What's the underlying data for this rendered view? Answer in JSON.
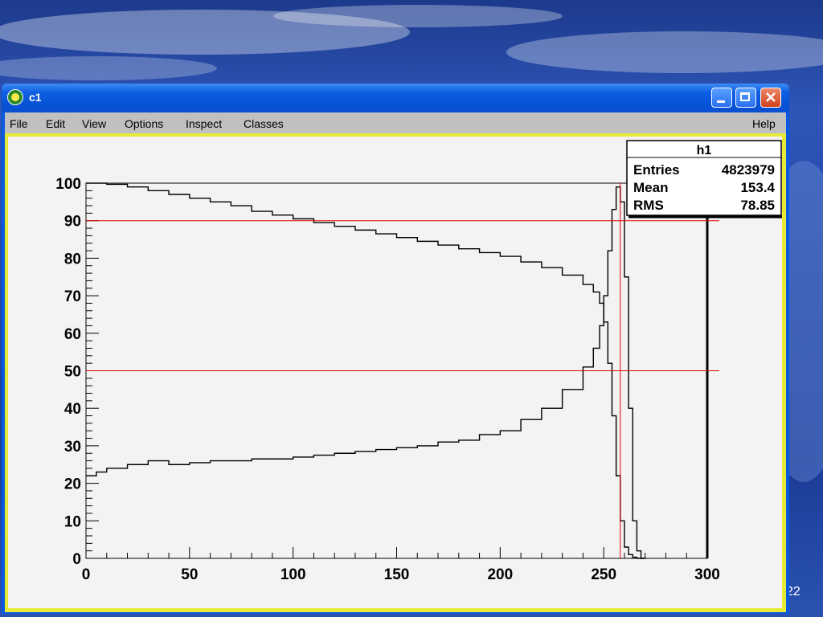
{
  "window": {
    "title": "c1",
    "menu": [
      "File",
      "Edit",
      "View",
      "Options",
      "Inspect",
      "Classes"
    ],
    "help": "Help"
  },
  "slide_number": "22",
  "stats": {
    "title": "h1",
    "rows": [
      {
        "label": "Entries",
        "value": "4823979"
      },
      {
        "label": "Mean",
        "value": "153.4"
      },
      {
        "label": "RMS",
        "value": "78.85"
      }
    ]
  },
  "colors": {
    "accent_line": "#e00000",
    "curve": "#000000",
    "titlebar": "#0a56d8"
  },
  "chart_data": {
    "type": "line",
    "title": "",
    "xlabel": "",
    "ylabel": "",
    "xlim": [
      0,
      300
    ],
    "ylim": [
      0,
      100
    ],
    "x_ticks": [
      0,
      50,
      100,
      150,
      200,
      250,
      300
    ],
    "y_ticks": [
      0,
      10,
      20,
      30,
      40,
      50,
      60,
      70,
      80,
      90,
      100
    ],
    "grid": false,
    "series": [
      {
        "name": "",
        "step": true,
        "x": [
          0,
          5,
          10,
          20,
          30,
          40,
          50,
          60,
          70,
          80,
          90,
          100,
          110,
          120,
          130,
          140,
          150,
          160,
          170,
          180,
          190,
          200,
          210,
          220,
          230,
          240,
          245,
          248,
          250,
          252,
          254,
          256,
          258,
          260,
          262,
          264,
          266,
          268
        ],
        "y": [
          22,
          23,
          24,
          25,
          26,
          25,
          25.5,
          26,
          26,
          26.5,
          26.5,
          27,
          27.5,
          28,
          28.5,
          29,
          29.5,
          30,
          31,
          31.5,
          33,
          34,
          37,
          40,
          45,
          51,
          56,
          62,
          70,
          82,
          93,
          99,
          95,
          75,
          40,
          10,
          2,
          0
        ]
      },
      {
        "name": "",
        "step": true,
        "x": [
          0,
          5,
          10,
          20,
          30,
          40,
          50,
          60,
          70,
          80,
          90,
          100,
          110,
          120,
          130,
          140,
          150,
          160,
          170,
          180,
          190,
          200,
          210,
          220,
          230,
          240,
          245,
          248,
          250,
          252,
          254,
          256,
          258,
          260,
          262,
          264,
          266,
          268
        ],
        "y": [
          100,
          100,
          99.7,
          99,
          98,
          97,
          96,
          95,
          94,
          92.5,
          91.5,
          90.5,
          89.5,
          88.5,
          87.5,
          86.5,
          85.5,
          84.5,
          83.5,
          82.5,
          81.5,
          80.5,
          79,
          77.5,
          75.5,
          73,
          71,
          68,
          63,
          52,
          38,
          22,
          10,
          3,
          1,
          0.3,
          0,
          0
        ]
      }
    ],
    "reference_lines": [
      {
        "orientation": "horizontal",
        "value": 90
      },
      {
        "orientation": "horizontal",
        "value": 50
      },
      {
        "orientation": "vertical",
        "value": 258
      }
    ]
  }
}
